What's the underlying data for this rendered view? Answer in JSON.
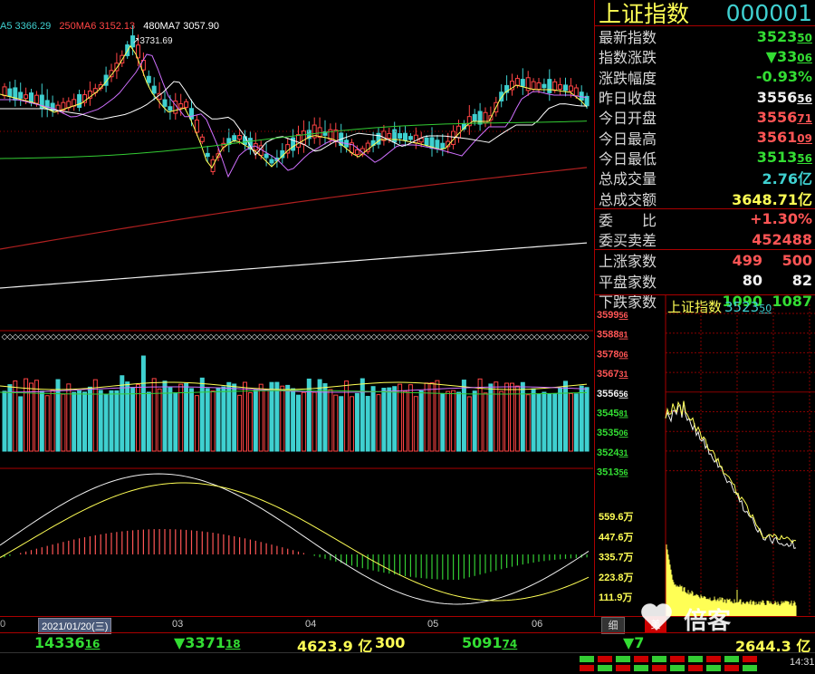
{
  "ma_legend": [
    {
      "text": "A5 3366.29",
      "color": "#3fd0d0"
    },
    {
      "text": "250MA6 3152.13",
      "color": "#ff4444"
    },
    {
      "text": "480MA7 3057.90",
      "color": "#ffffff"
    }
  ],
  "main_chart": {
    "high_annotation": "3731.69",
    "x_axis_labels": [
      "03",
      "04",
      "05",
      "06"
    ],
    "selected_date": "2021/01/20(三)"
  },
  "panel": {
    "name": "上证指数",
    "code": "000001",
    "rows": [
      {
        "label": "最新指数",
        "value": "3523",
        "value_dec": "50",
        "color": "#33dd33"
      },
      {
        "label": "指数涨跌",
        "value": "▼33",
        "value_dec": "06",
        "color": "#33dd33"
      },
      {
        "label": "涨跌幅度",
        "value": "-0.93%",
        "value_dec": "",
        "color": "#33dd33"
      },
      {
        "label": "昨日收盘",
        "value": "3556",
        "value_dec": "56",
        "color": "#f0f0f0"
      },
      {
        "label": "今日开盘",
        "value": "3556",
        "value_dec": "71",
        "color": "#ff5555"
      },
      {
        "label": "今日最高",
        "value": "3561",
        "value_dec": "09",
        "color": "#ff5555"
      },
      {
        "label": "今日最低",
        "value": "3513",
        "value_dec": "56",
        "color": "#33dd33"
      },
      {
        "label": "总成交量",
        "value": "2.76亿",
        "value_dec": "",
        "color": "#3fd0d0"
      },
      {
        "label": "总成交额",
        "value": "3648.71亿",
        "value_dec": "",
        "color": "#ffff55"
      }
    ],
    "rows2": [
      {
        "label": "委　　比",
        "value": "+1.30%",
        "color": "#ff5555"
      },
      {
        "label": "委买卖差",
        "value": "452488",
        "color": "#ff5555"
      }
    ],
    "rows3": [
      {
        "label": "上涨家数",
        "v1": "499",
        "v2": "500",
        "color": "#ff5555"
      },
      {
        "label": "平盘家数",
        "v1": "80",
        "v2": "82",
        "color": "#f0f0f0"
      },
      {
        "label": "下跌家数",
        "v1": "1090",
        "v2": "1087",
        "color": "#33dd33"
      }
    ]
  },
  "intraday": {
    "title": "上证指数",
    "price": "3523",
    "price_dec": "50",
    "price_labels": [
      {
        "int": "3599",
        "dec": "56",
        "color": "#ff5555"
      },
      {
        "int": "3588",
        "dec": "81",
        "color": "#ff5555"
      },
      {
        "int": "3578",
        "dec": "06",
        "color": "#ff5555"
      },
      {
        "int": "3567",
        "dec": "31",
        "color": "#ff5555"
      },
      {
        "int": "3556",
        "dec": "56",
        "color": "#f0f0f0"
      },
      {
        "int": "3545",
        "dec": "81",
        "color": "#33dd33"
      },
      {
        "int": "3535",
        "dec": "06",
        "color": "#33dd33"
      },
      {
        "int": "3524",
        "dec": "31",
        "color": "#33dd33"
      },
      {
        "int": "3513",
        "dec": "56",
        "color": "#33dd33"
      }
    ],
    "volume_labels": [
      "559.6万",
      "447.6万",
      "335.7万",
      "223.8万",
      "111.9万"
    ]
  },
  "status_bar": {
    "index1_int": "14336",
    "index1_dec": "16",
    "index1_chg_int": "▼3371",
    "index1_chg_dec": "18",
    "amount1": "4623.9 亿",
    "index2_name": "300",
    "index2_int": "5091",
    "index2_dec": "74",
    "index2_chg": "▼7",
    "amount2": "2644.3 亿"
  },
  "tabs": {
    "tab1": "细",
    "tab2": "美"
  },
  "watermark": "倍客",
  "clock": "14:31"
}
